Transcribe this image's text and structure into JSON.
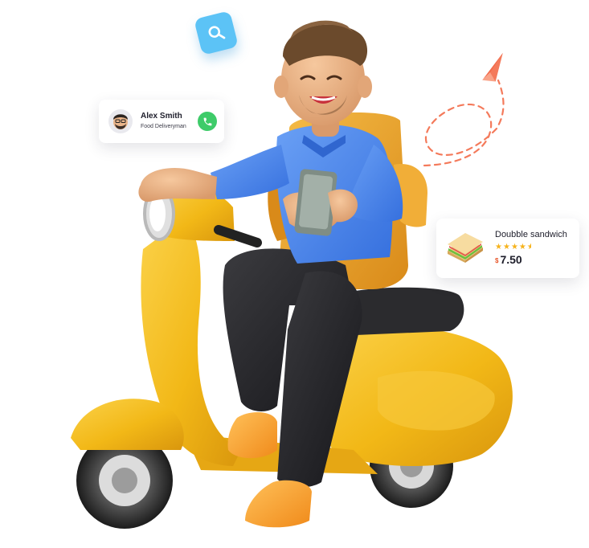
{
  "contact": {
    "name": "Alex Smith",
    "role": "Food Deliveryman"
  },
  "food": {
    "name": "Doubble sandwich",
    "rating": 4.5,
    "currency": "$",
    "price": "7.50"
  },
  "icons": {
    "search": "search-icon",
    "phone": "phone-icon",
    "plane": "paper-plane-icon",
    "sandwich": "sandwich-icon",
    "star": "star-icon"
  },
  "colors": {
    "scooter": "#f2b817",
    "shirt": "#4a86ee",
    "bag": "#e9a22a",
    "call": "#3ecb69",
    "accent": "#f47a5b",
    "search": "#5cc3f6"
  }
}
